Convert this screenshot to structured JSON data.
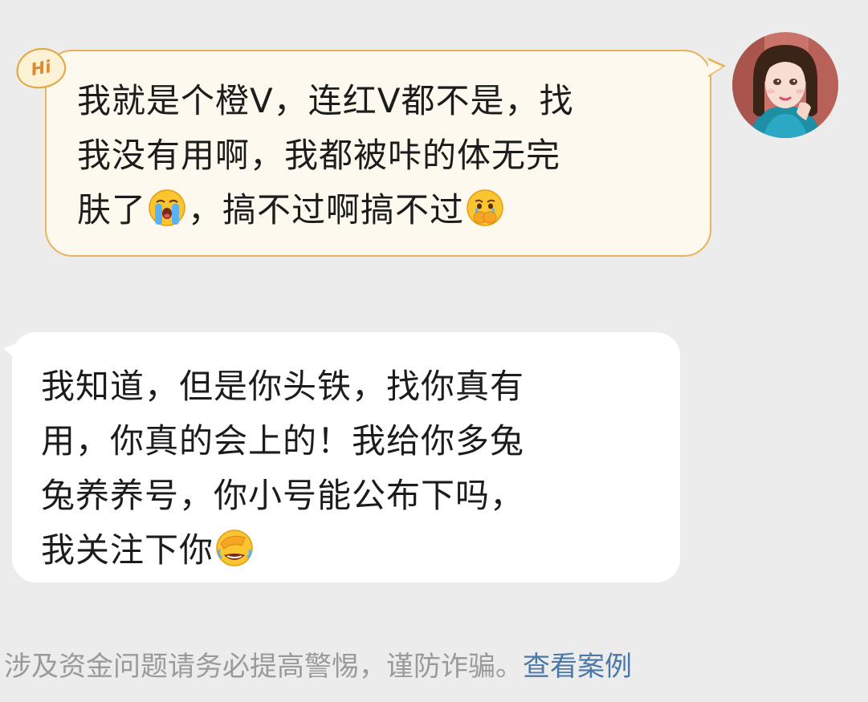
{
  "messages": [
    {
      "direction": "outgoing",
      "badge": "Hi",
      "segments": {
        "line1": "我就是个橙V，连红V都不是，找",
        "line2": "我没有用啊，我都被咔的体无完",
        "line3_a": "肤了",
        "line3_b": "，搞不过啊搞不过"
      },
      "emoji": [
        "loudly-crying-emoji",
        "hand-over-mouth-crying-emoji"
      ]
    },
    {
      "direction": "incoming",
      "segments": {
        "line1": "我知道，但是你头铁，找你真有",
        "line2": "用，你真的会上的！我给你多兔",
        "line3": "兔养养号，你小号能公布下吗，",
        "line4": "我关注下你"
      },
      "emoji": [
        "laughing-face-palm-emoji"
      ]
    }
  ],
  "notice": {
    "text": "涉及资金问题请务必提高警惕，谨防诈骗。",
    "link_label": "查看案例"
  },
  "colors": {
    "background": "#ececec",
    "outgoing_bubble": "#fdf9ee",
    "outgoing_border": "#e8b35a",
    "incoming_bubble": "#ffffff",
    "link": "#4c78a8",
    "notice_text": "#9a9a9a"
  }
}
